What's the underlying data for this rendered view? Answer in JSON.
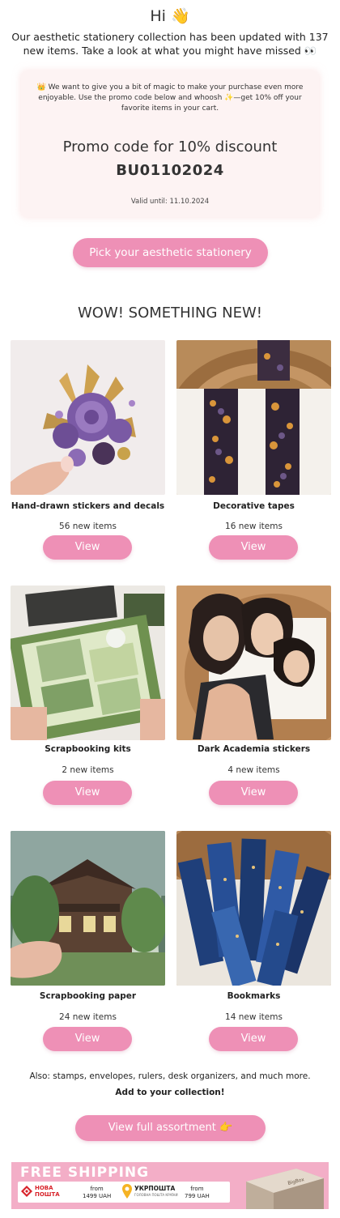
{
  "header": {
    "greeting": "Hi 👋",
    "intro": "Our aesthetic stationery collection has been updated with 137 new items. Take a look at what you might have missed 👀"
  },
  "promo": {
    "message": "👑 We want to give you a bit of magic to make your purchase even more enjoyable. Use the promo code below and whoosh ✨—get 10% off your favorite items in your cart.",
    "title": "Promo code for 10% discount",
    "code": "BU01102024",
    "valid": "Valid until: 11.10.2024"
  },
  "cta_main": "Pick your aesthetic stationery",
  "section_title": "WOW! SOMETHING NEW!",
  "products": [
    {
      "title": "Hand-drawn stickers and decals",
      "count": "56 new items",
      "button": "View"
    },
    {
      "title": "Decorative tapes",
      "count": "16 new items",
      "button": "View"
    },
    {
      "title": "Scrapbooking kits",
      "count": "2 new items",
      "button": "View"
    },
    {
      "title": "Dark Academia stickers",
      "count": "4 new items",
      "button": "View"
    },
    {
      "title": "Scrapbooking paper",
      "count": "24 new items",
      "button": "View"
    },
    {
      "title": "Bookmarks",
      "count": "14 new items",
      "button": "View"
    }
  ],
  "footer": {
    "also": "Also: stamps, envelopes, rulers, desk organizers, and much more.",
    "add": "Add to your collection!",
    "cta_full": "View full assortment 👉"
  },
  "shipping": {
    "title": "FREE SHIPPING",
    "carrier1": "НОВА\nПОШТА",
    "carrier1_from": "from\n1499 UAH",
    "carrier2": "УКРПОШТА",
    "carrier2_sub": "ГОЛОВНА ПОШТА КРАЇНИ",
    "carrier2_from": "from\n799 UAH",
    "box_brand": "BigBox"
  },
  "colors": {
    "accent": "#ee90b6",
    "promo_bg": "#fdf3f3",
    "banner": "#f3aec7"
  }
}
